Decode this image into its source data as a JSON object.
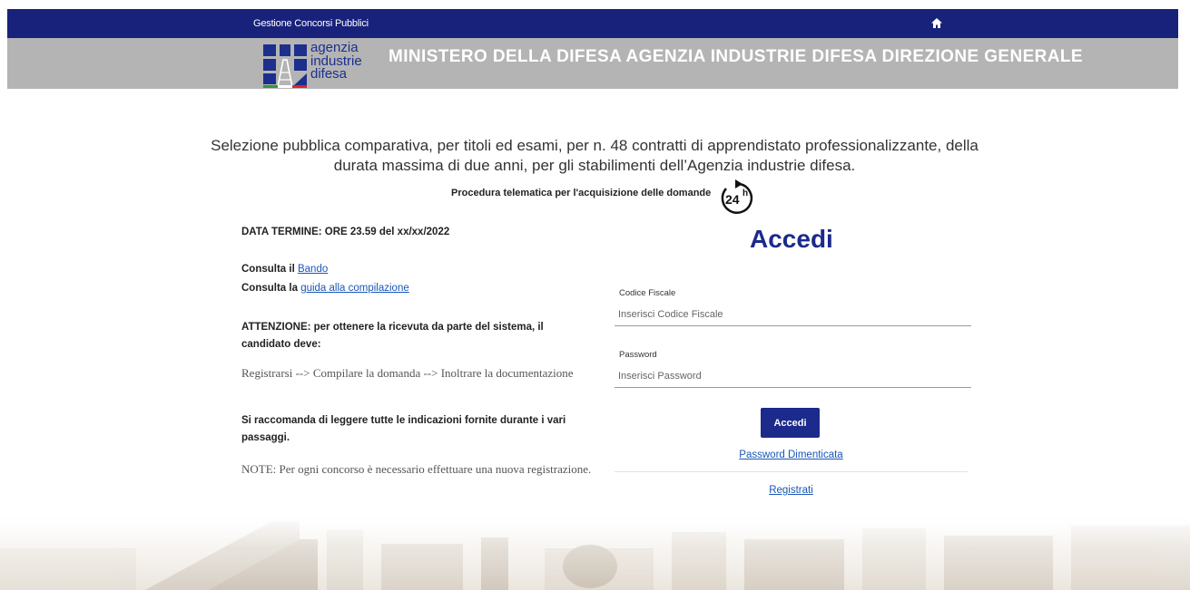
{
  "topbar": {
    "app_title": "Gestione Concorsi Pubblici"
  },
  "header": {
    "logo_text": [
      "agenzia",
      "industrie",
      "difesa"
    ],
    "title": "MINISTERO DELLA DIFESA AGENZIA INDUSTRIE DIFESA DIREZIONE GENERALE"
  },
  "intro": {
    "line1": "Selezione pubblica comparativa, per titoli ed esami, per n. 48 contratti di apprendistato professionalizzante, della",
    "line2": "durata massima di due anni, per gli stabilimenti dell’Agenzia industrie difesa.",
    "procedure": "Procedura telematica per l'acquisizione delle domande",
    "clock_label": "24h"
  },
  "left": {
    "deadline": "DATA TERMINE: ORE 23.59 del xx/xx/2022",
    "consult1_prefix": "Consulta il ",
    "consult1_link": "Bando",
    "consult2_prefix": "Consulta la ",
    "consult2_link": "guida alla compilazione",
    "attention": "ATTENZIONE: per ottenere la ricevuta da parte del sistema, il candidato deve:",
    "steps": "Registrarsi --> Compilare la domanda --> Inoltrare la documentazione",
    "recommend": "Si raccomanda di leggere tutte le indicazioni fornite durante i vari passaggi.",
    "note": "NOTE: Per ogni concorso è necessario effettuare una nuova registrazione."
  },
  "login": {
    "title": "Accedi",
    "cf_label": "Codice Fiscale",
    "cf_placeholder": "Inserisci Codice Fiscale",
    "pw_label": "Password",
    "pw_placeholder": "Inserisci Password",
    "submit_label": "Accedi",
    "forgot_label": "Password Dimenticata",
    "register_label": "Registrati"
  },
  "colors": {
    "navy": "#19227a",
    "header_grey": "#b4b4b4",
    "accent_blue": "#1c2a8c",
    "link": "#1a56b8"
  },
  "icons": {
    "home": "home-icon",
    "clock": "clock-24h-icon"
  }
}
